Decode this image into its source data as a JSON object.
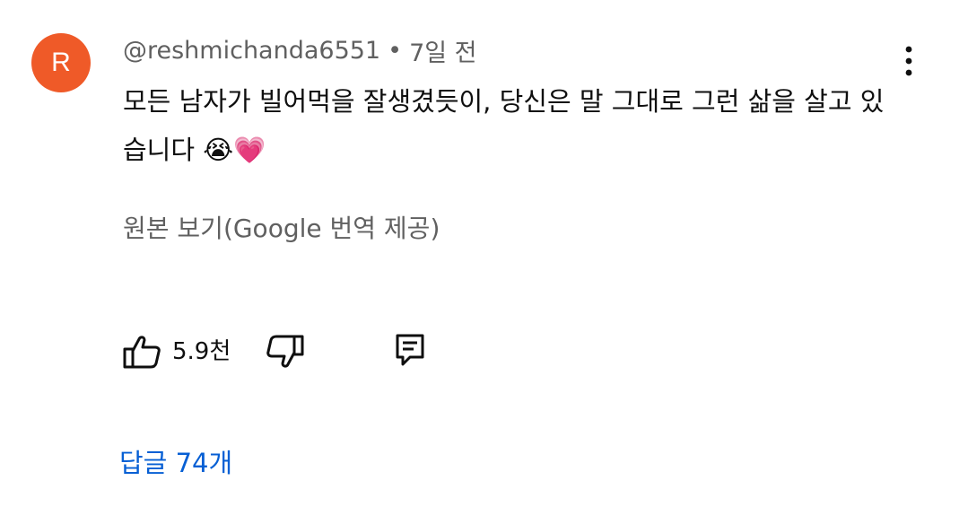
{
  "comment": {
    "avatar_letter": "R",
    "avatar_color": "#ef5a28",
    "author": "@reshmichanda6551",
    "separator": "•",
    "time": "7일 전",
    "text": "모든 남자가 빌어먹을 잘생겼듯이, 당신은 말 그대로 그런 삶을 살고 있습니다 😭💗",
    "translate_label": "원본 보기(Google 번역 제공)",
    "like_count": "5.9천",
    "replies_label": "답글 74개"
  },
  "icons": {
    "more": "more-vertical-icon",
    "like": "thumbs-up-icon",
    "dislike": "thumbs-down-icon",
    "reply": "reply-comment-icon"
  },
  "colors": {
    "link_blue": "#065fd4",
    "secondary_text": "#606060"
  }
}
